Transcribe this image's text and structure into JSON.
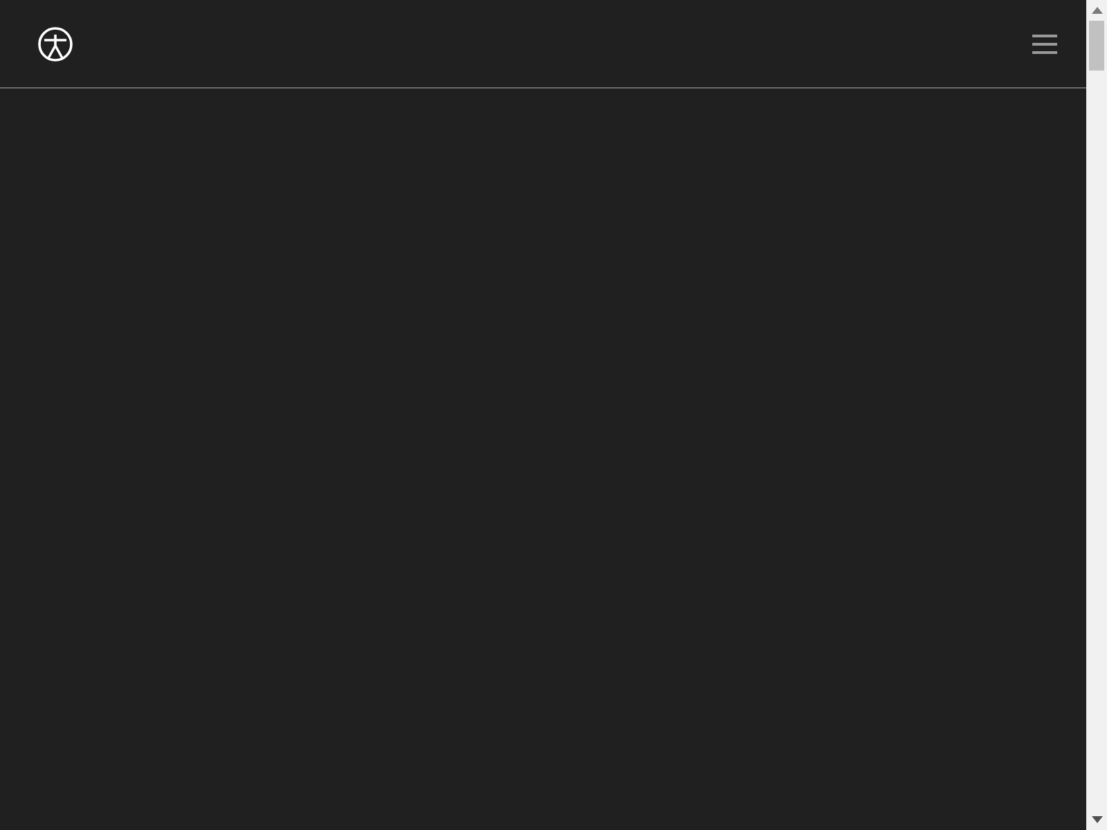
{
  "header": {
    "menu": {
      "expanded": false
    }
  }
}
